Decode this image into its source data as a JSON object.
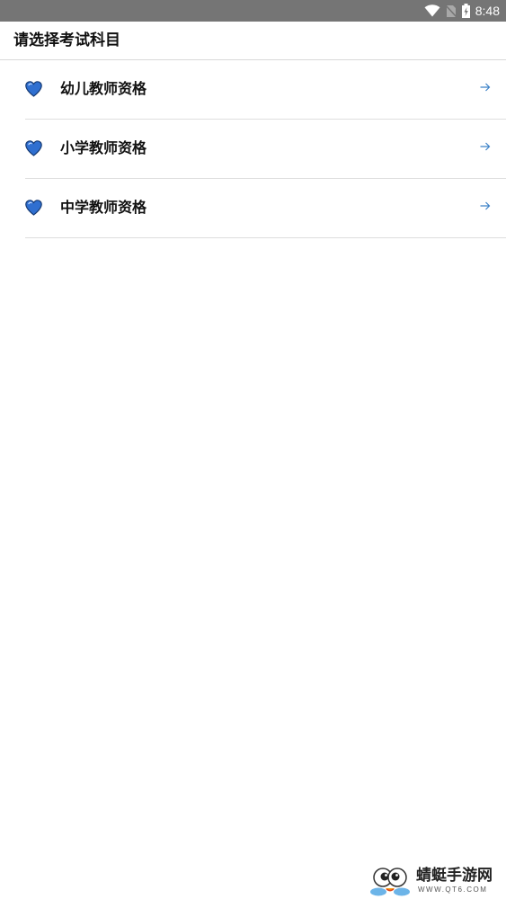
{
  "status_bar": {
    "time": "8:48",
    "icons": [
      "wifi-icon",
      "no-sim-icon",
      "battery-charging-icon"
    ]
  },
  "app_bar": {
    "title": "请选择考试科目"
  },
  "subjects": [
    {
      "label": "幼儿教师资格",
      "icon": "blue-heart-icon",
      "action_icon": "arrow-right-icon"
    },
    {
      "label": "小学教师资格",
      "icon": "blue-heart-icon",
      "action_icon": "arrow-right-icon"
    },
    {
      "label": "中学教师资格",
      "icon": "blue-heart-icon",
      "action_icon": "arrow-right-icon"
    }
  ],
  "watermark": {
    "name": "蜻蜓手游网",
    "url": "WWW.QT6.COM"
  },
  "colors": {
    "status_bar_bg": "#757575",
    "heart_blue": "#2f6fd0",
    "arrow_blue": "#3d82c8",
    "divider": "#dedede"
  }
}
